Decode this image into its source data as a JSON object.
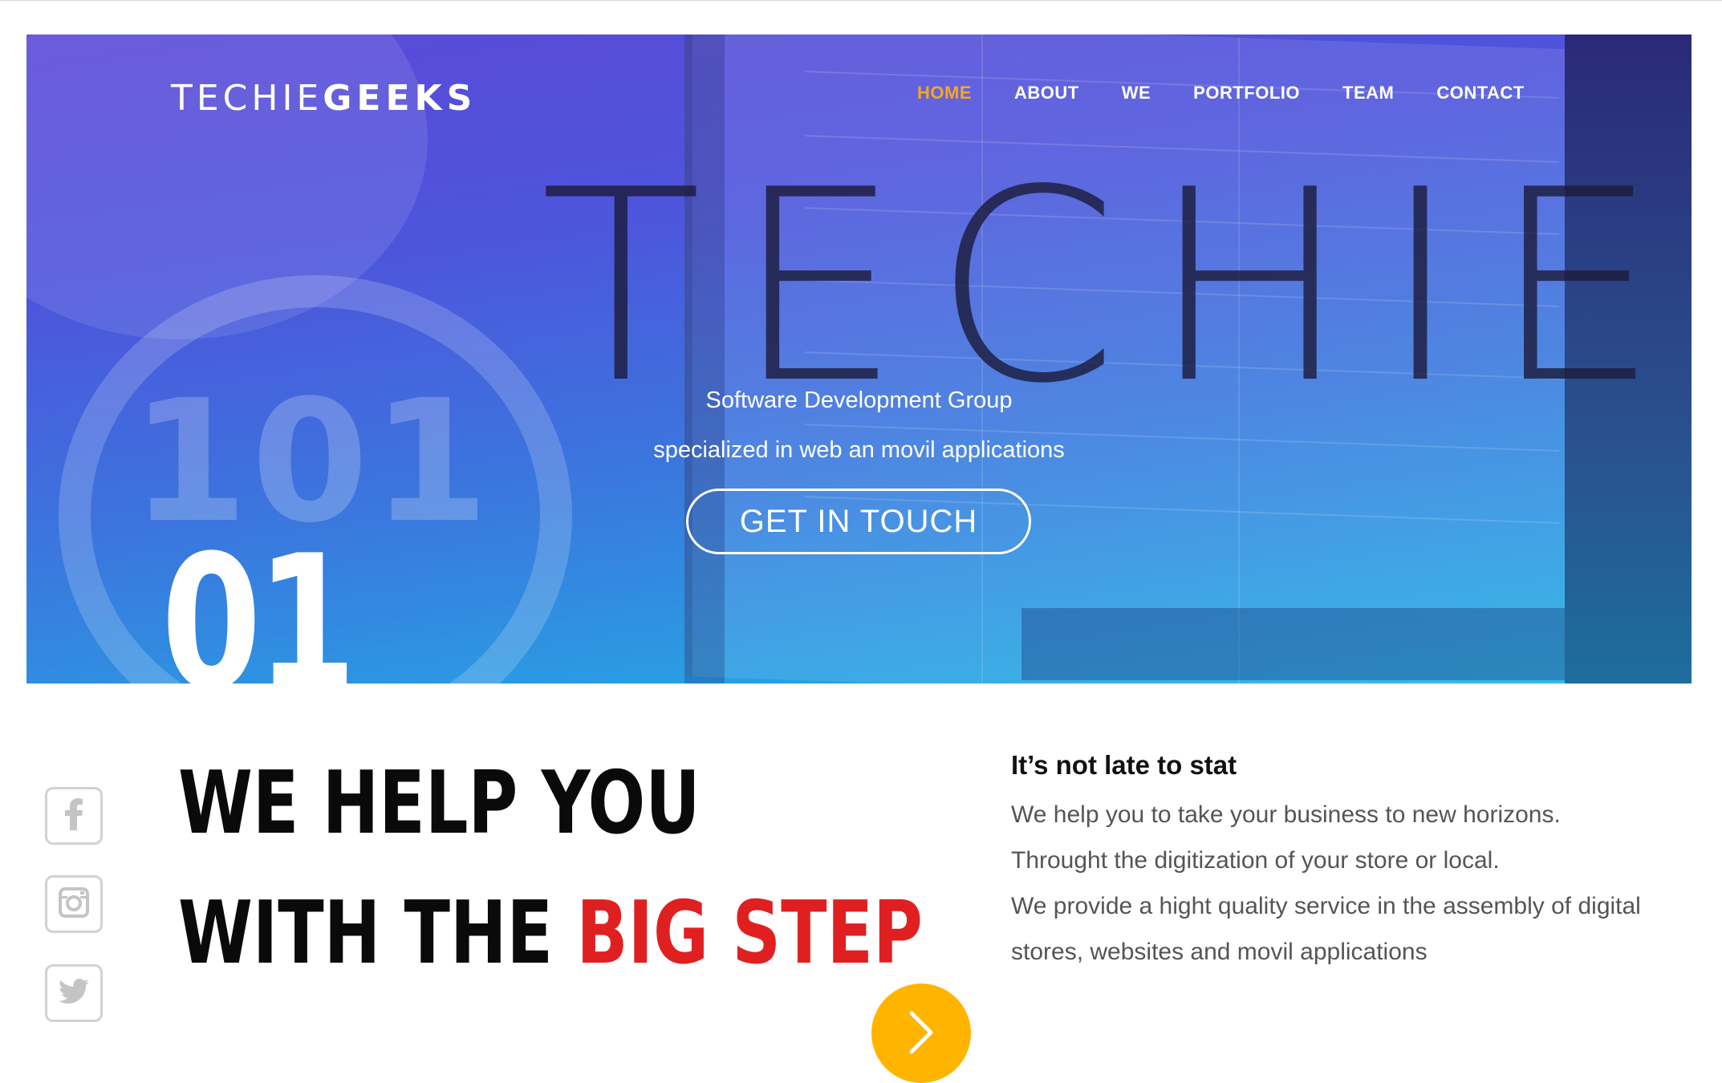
{
  "brand": {
    "logo_part1": "TECHIE",
    "logo_part2": "GEEKS"
  },
  "nav": {
    "items": [
      {
        "label": "HOME",
        "active": true
      },
      {
        "label": "ABOUT",
        "active": false
      },
      {
        "label": "WE",
        "active": false
      },
      {
        "label": "PORTFOLIO",
        "active": false
      },
      {
        "label": "TEAM",
        "active": false
      },
      {
        "label": "CONTACT",
        "active": false
      }
    ]
  },
  "hero": {
    "big_word": "TECHIE",
    "watermark_number": "101",
    "slide_number": "01",
    "subtitle_line1": "Software Development Group",
    "subtitle_line2": "specialized in web an movil applications",
    "cta_label": "GET IN TOUCH"
  },
  "social": {
    "icons": [
      "facebook-icon",
      "instagram-icon",
      "twitter-icon"
    ]
  },
  "headline": {
    "line1": "WE HELP YOU",
    "line2_prefix": "WITH THE ",
    "line2_highlight": "BIG STEP"
  },
  "info": {
    "title": "It’s not late to stat",
    "lines": [
      "We help you to take your business to new horizons.",
      "Throught the digitization of your store or local.",
      "We provide a hight quality service in the assembly of digital",
      "stores, websites and movil applications"
    ]
  },
  "colors": {
    "accent_orange": "#f5a623",
    "highlight_red": "#e02020",
    "button_yellow": "#ffb400"
  }
}
